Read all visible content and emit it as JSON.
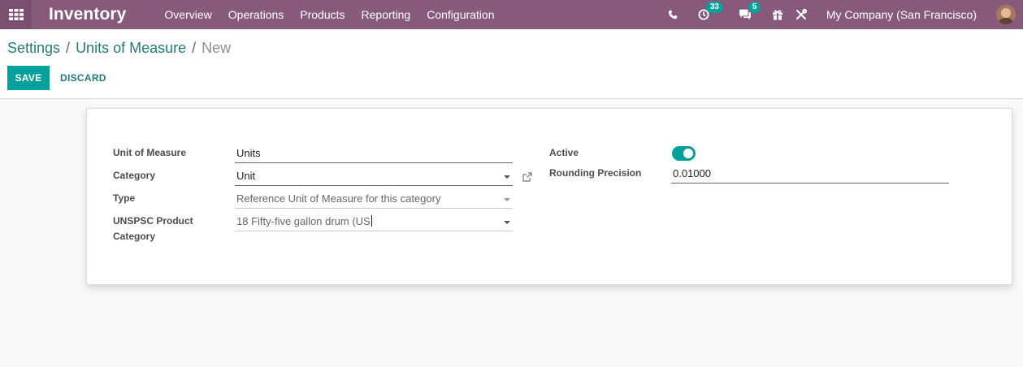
{
  "navbar": {
    "app_name": "Inventory",
    "menu": [
      "Overview",
      "Operations",
      "Products",
      "Reporting",
      "Configuration"
    ],
    "activity_count": "33",
    "message_count": "5",
    "company": "My Company (San Francisco)",
    "icons": [
      "apps-grid-icon",
      "phone-icon",
      "activity-clock-icon",
      "chat-icon",
      "gift-icon",
      "debug-tools-icon"
    ],
    "accent_color": "#875a7b"
  },
  "breadcrumb": {
    "settings": "Settings",
    "sep1": "/",
    "uom": "Units of Measure",
    "sep2": "/",
    "current": "New"
  },
  "buttons": {
    "save": "SAVE",
    "discard": "DISCARD",
    "primary_color": "#00a09d"
  },
  "form": {
    "uom_label": "Unit of Measure",
    "uom_value": "Units",
    "category_label": "Category",
    "category_value": "Unit",
    "type_label": "Type",
    "type_value": "Reference Unit of Measure for this category",
    "unspsc_label_1": "UNSPSC Product",
    "unspsc_label_2": "Category",
    "unspsc_value": "18 Fifty-five gallon drum (US",
    "active_label": "Active",
    "active_on": true,
    "rounding_label": "Rounding Precision",
    "rounding_value": "0.01000"
  }
}
